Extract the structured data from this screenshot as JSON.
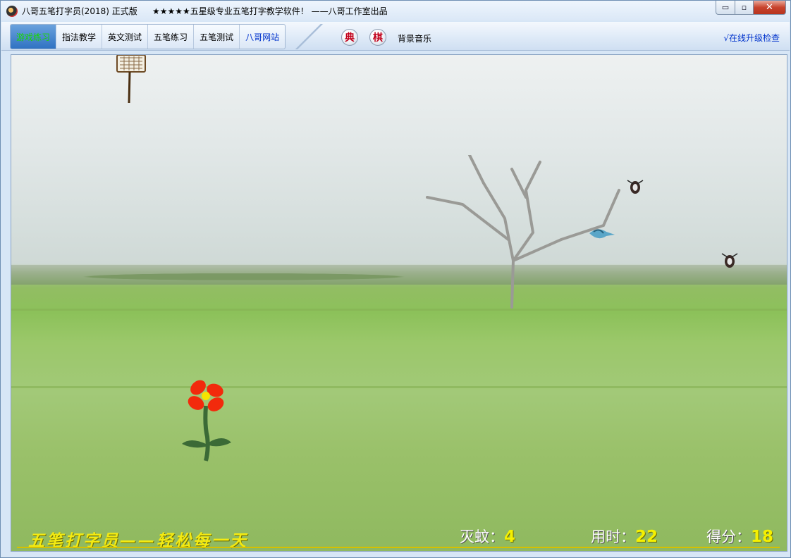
{
  "window": {
    "title": "八哥五笔打字员(2018) 正式版",
    "subtitle": "★★★★★五星级专业五笔打字教学软件！ ——八哥工作室出品",
    "controls": {
      "minimize": "▭",
      "maximize": "▫",
      "close": "✕"
    }
  },
  "menu": {
    "tabs": [
      {
        "label": "游戏练习"
      },
      {
        "label": "指法教学"
      },
      {
        "label": "英文测试"
      },
      {
        "label": "五笔练习"
      },
      {
        "label": "五笔测试"
      },
      {
        "label": "八哥网站"
      }
    ],
    "dian": "典",
    "qi": "棋",
    "music": "背景音乐",
    "upgrade": "√在线升级检查"
  },
  "game": {
    "slogan": "五笔打字员——轻松每一天",
    "mosquitoes_label": "灭蚊：",
    "mosquitoes_value": "4",
    "time_label": "用时：",
    "time_value": "22",
    "score_label": "得分：",
    "score_value": "18"
  },
  "colors": {
    "slogan": "#f3ea12",
    "stat_value": "#f5f000",
    "active_tab_text": "#18d800",
    "link": "#0033cc",
    "flower": "#f22a0c"
  }
}
